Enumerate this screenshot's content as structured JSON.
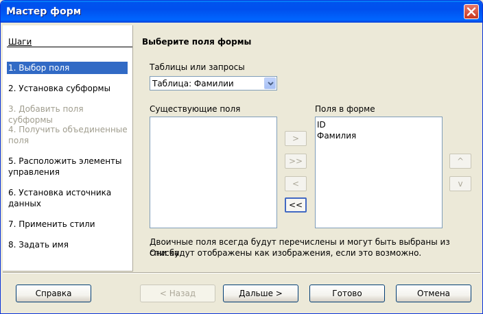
{
  "window": {
    "title": "Мастер форм"
  },
  "steps": {
    "title": "Шаги",
    "items": [
      {
        "label": "1. Выбор поля",
        "state": "selected"
      },
      {
        "label": "2. Установка субформы",
        "state": "enabled"
      },
      {
        "label": "3. Добавить поля субформы",
        "state": "disabled"
      },
      {
        "label": "4. Получить объединенные поля",
        "state": "disabled"
      },
      {
        "label": "5. Расположить элементы управления",
        "state": "enabled"
      },
      {
        "label": "6. Установка источника данных",
        "state": "enabled"
      },
      {
        "label": "7. Применить стили",
        "state": "enabled"
      },
      {
        "label": "8. Задать имя",
        "state": "enabled"
      }
    ]
  },
  "main": {
    "heading": "Выберите поля формы",
    "tables_label": "Таблицы или запросы",
    "tables_value": "Таблица: Фамилии",
    "existing_label": "Существующие поля",
    "form_fields_label": "Поля в форме",
    "form_fields": [
      "ID",
      "Фамилия"
    ],
    "move_buttons": {
      "add_one": ">",
      "add_all": ">>",
      "remove_one": "<",
      "remove_all": "<<"
    },
    "order_buttons": {
      "up": "^",
      "down": "v"
    },
    "note_line1": "Двоичные поля всегда будут перечислены и могут быть выбраны из списка.",
    "note_line2": "Они будут отображены как изображения, если это возможно."
  },
  "buttons": {
    "help": "Справка",
    "back": "< Назад",
    "next": "Дальше >",
    "finish": "Готово",
    "cancel": "Отмена"
  },
  "colors": {
    "selection": "#316ac5",
    "titlebar": "#0053ee",
    "dialog_bg": "#ece9d8"
  }
}
